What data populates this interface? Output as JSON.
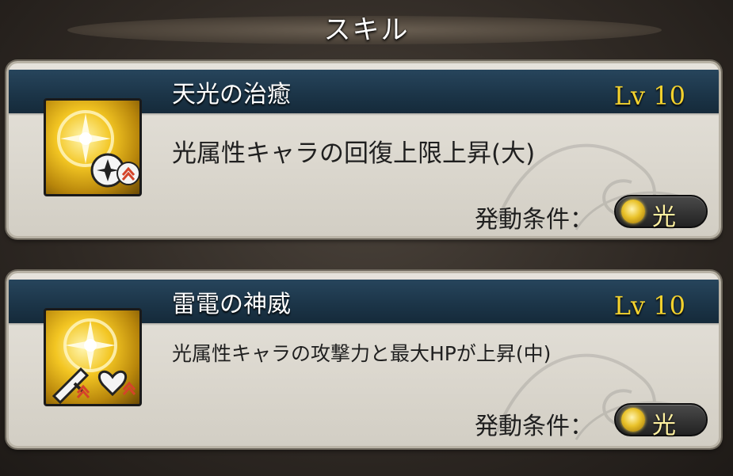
{
  "header": {
    "title": "スキル"
  },
  "skills": [
    {
      "name": "天光の治癒",
      "level": "Lv 10",
      "description": "光属性キャラの回復上限上昇(大)",
      "condition_label": "発動条件：",
      "condition_value": "光",
      "icon": "light-orb-heal-up-icon"
    },
    {
      "name": "雷電の神威",
      "level": "Lv 10",
      "description": "光属性キャラの攻撃力と最大HPが上昇(中)",
      "condition_label": "発動条件：",
      "condition_value": "光",
      "icon": "light-orb-attack-hp-up-icon"
    }
  ],
  "colors": {
    "level": "#f2d12e",
    "band": "#1b3447",
    "light_element": "#e9c22a"
  }
}
